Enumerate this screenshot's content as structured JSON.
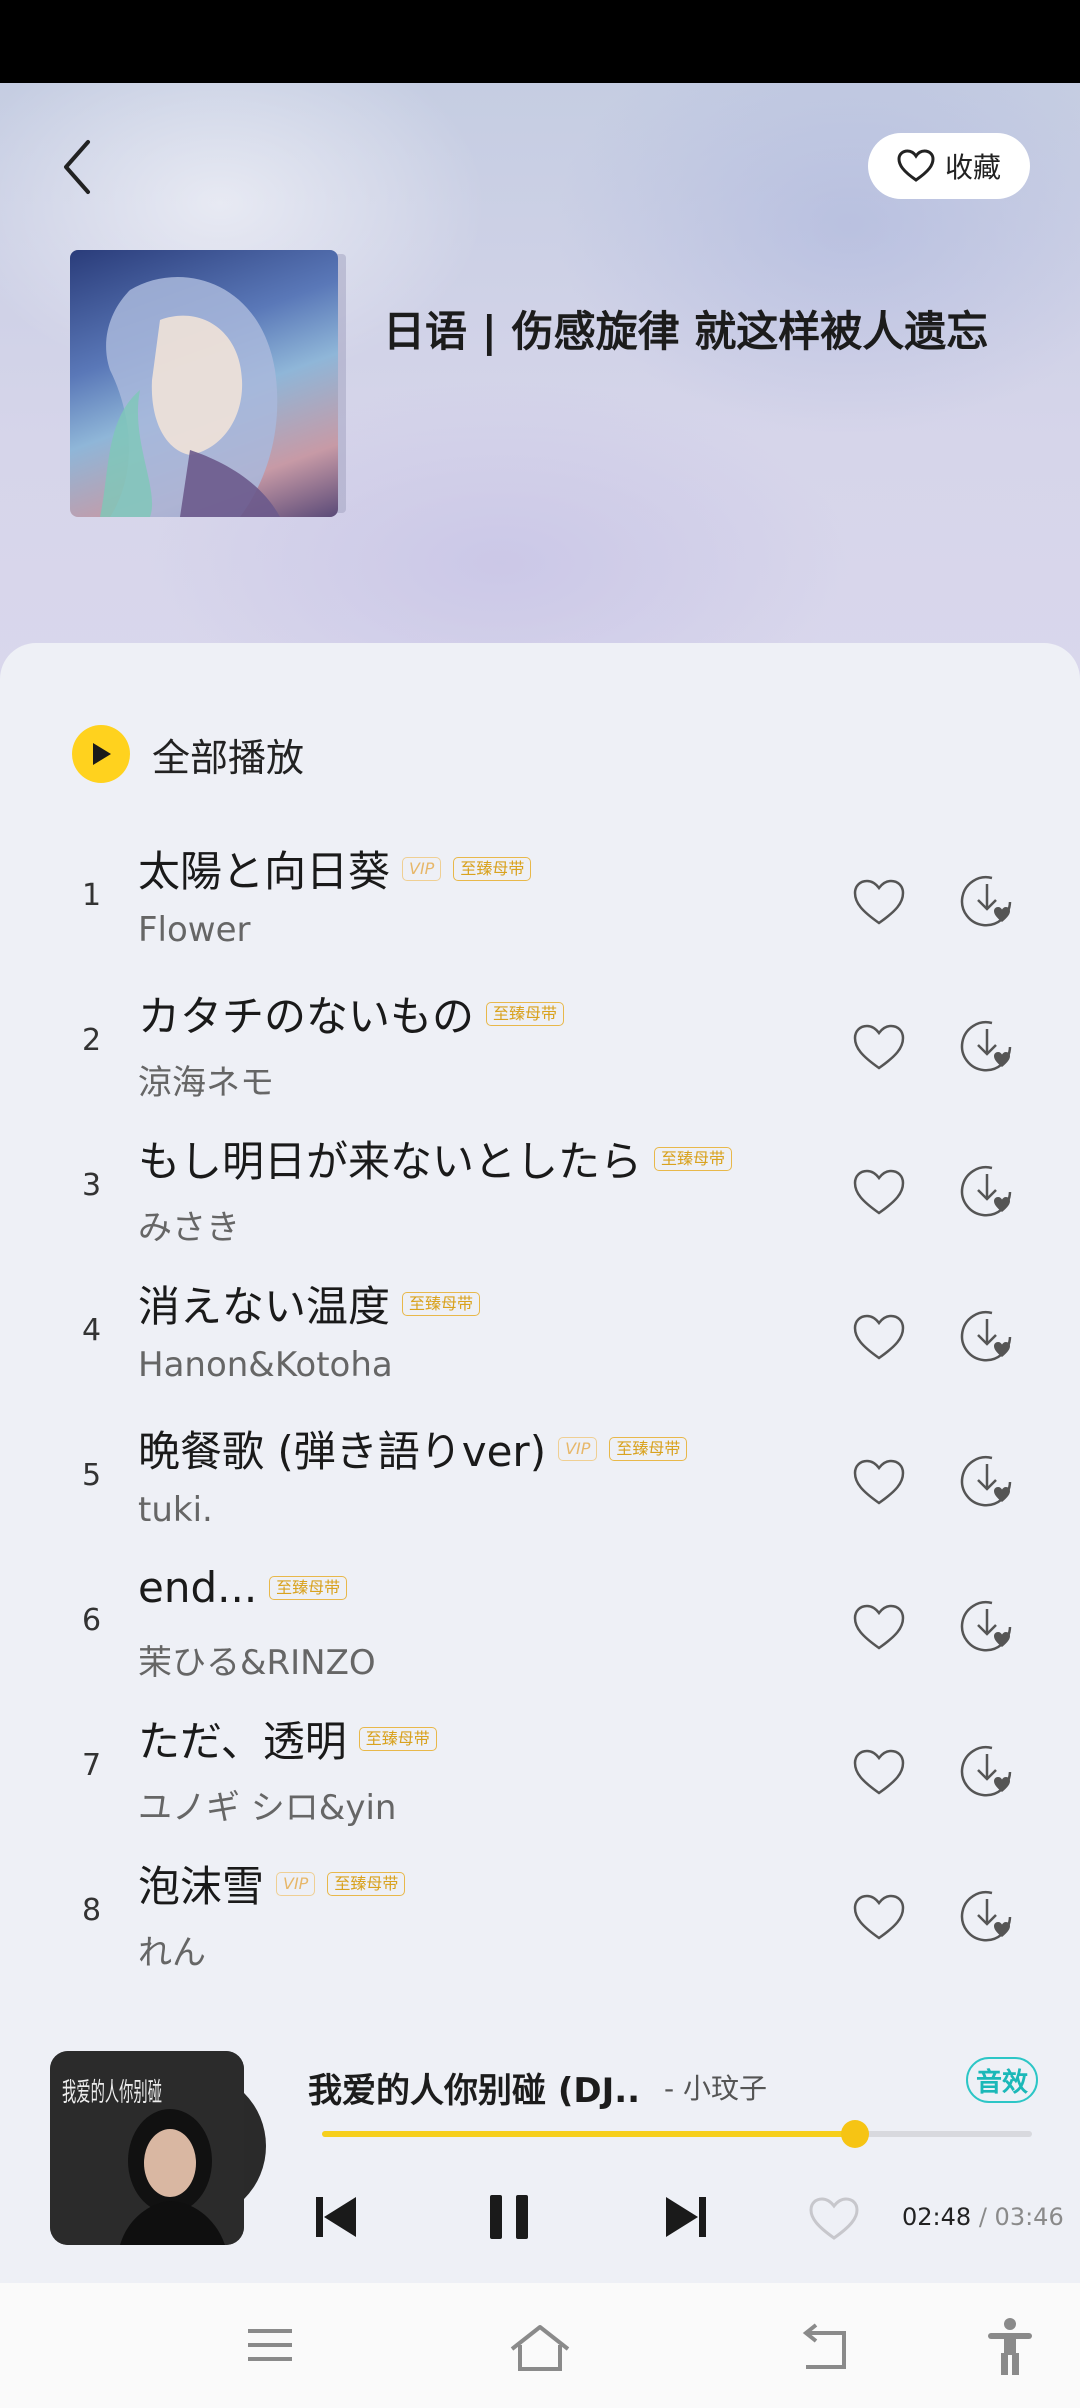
{
  "header": {
    "collect_label": "收藏",
    "playlist_title": "日语 | 伤感旋律 就这样被人遗忘"
  },
  "play_all_label": "全部播放",
  "songs": [
    {
      "index": "1",
      "title": "太陽と向日葵",
      "vip": true,
      "master": true,
      "artist": "Flower"
    },
    {
      "index": "2",
      "title": "カタチのないもの",
      "vip": false,
      "master": true,
      "artist": "涼海ネモ"
    },
    {
      "index": "3",
      "title": "もし明日が来ないとしたら",
      "vip": false,
      "master": true,
      "artist": "みさき"
    },
    {
      "index": "4",
      "title": "消えない温度",
      "vip": false,
      "master": true,
      "artist": "Hanon&Kotoha"
    },
    {
      "index": "5",
      "title": "晩餐歌 (弾き語りver)",
      "vip": true,
      "master": true,
      "artist": "tuki."
    },
    {
      "index": "6",
      "title": "end...",
      "vip": false,
      "master": true,
      "artist": "茉ひる&RINZO"
    },
    {
      "index": "7",
      "title": "ただ、透明",
      "vip": false,
      "master": true,
      "artist": "ユノギ シロ&yin"
    },
    {
      "index": "8",
      "title": "泡沫雪",
      "vip": true,
      "master": true,
      "artist": "れん"
    }
  ],
  "badges": {
    "vip": "VIP",
    "master": "至臻母带"
  },
  "player": {
    "title": "我爱的人你别碰 (DJ..",
    "artist": "- 小玟子",
    "effect_label": "音效",
    "current_time": "02:48",
    "separator": "/",
    "total_time": "03:46",
    "progress": 0.75,
    "cover_text": "我爱的人你别碰"
  },
  "colors": {
    "accent": "#ffd21e",
    "effect": "#1bb8b8",
    "badge": "#d9a21e"
  }
}
